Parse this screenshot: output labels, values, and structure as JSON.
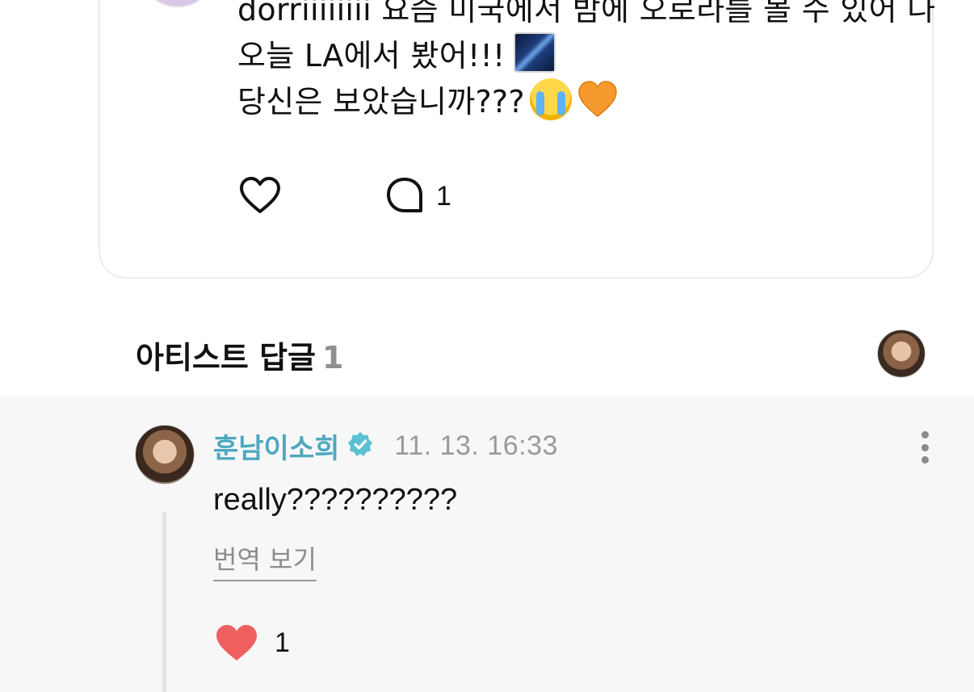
{
  "post": {
    "lines": [
      "dorriiiiiiii 요즘 미국에서 밤에 오로라를 볼 수 있어 나",
      "오늘 LA에서 봤어!!!",
      "당신은 보았습니까???"
    ],
    "emoji": [
      "milky-way",
      "loudly-crying-face",
      "orange-heart"
    ],
    "comment_count": "1"
  },
  "replies": {
    "title": "아티스트 답글",
    "count": "1"
  },
  "reply": {
    "author": "훈남이소희",
    "timestamp": "11. 13. 16:33",
    "text": "really??????????",
    "translate_label": "번역 보기",
    "like_count": "1"
  },
  "colors": {
    "author": "#4da8bf",
    "verified": "#5bc0d0",
    "liked_heart": "#ef5f5f",
    "reply_background": "#f7f7f8"
  }
}
